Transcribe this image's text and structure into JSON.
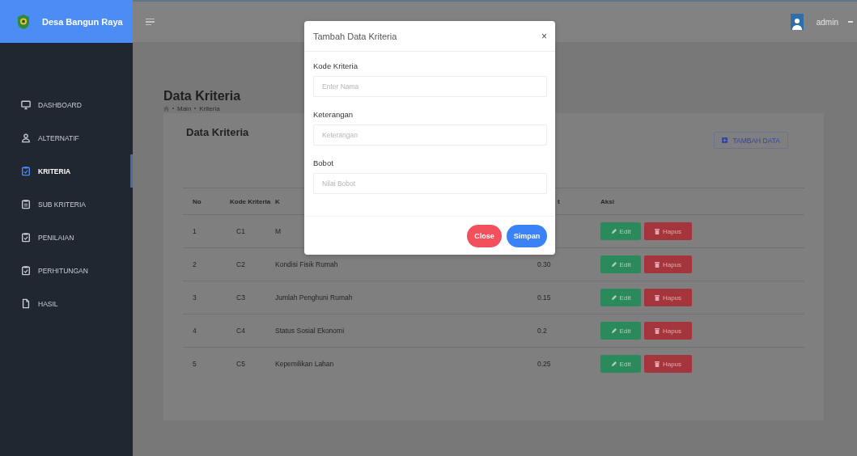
{
  "sidebar": {
    "brand": "Desa Bangun Raya",
    "items": [
      {
        "label": "DASHBOARD",
        "selected": false
      },
      {
        "label": "ALTERNATIF",
        "selected": false
      },
      {
        "label": "KRITERIA",
        "selected": true
      },
      {
        "label": "SUB KRITERIA",
        "selected": false
      },
      {
        "label": "PENILAIAN",
        "selected": false
      },
      {
        "label": "PERHITUNGAN",
        "selected": false
      },
      {
        "label": "HASIL",
        "selected": false
      }
    ]
  },
  "topbar": {
    "user": "admin"
  },
  "page": {
    "title": "Data Kriteria",
    "breadcrumb": [
      "Main",
      "Kriteria"
    ]
  },
  "card": {
    "title": "Data Kriteria",
    "add_button": "TAMBAH DATA"
  },
  "table": {
    "columns": [
      "No",
      "Kode Kriteria",
      "K",
      "t",
      "Aksi"
    ],
    "rows": [
      {
        "no": "1",
        "code": "C1",
        "description": "M",
        "actions": [
          {
            "label": "Edit",
            "kind": "edit"
          },
          {
            "label": "Hapus",
            "kind": "delete"
          }
        ]
      },
      {
        "no": "2",
        "code": "C2",
        "description": "Kondisi Fisik Rumah",
        "weight": "0.30",
        "actions": [
          {
            "label": "Edit",
            "kind": "edit"
          },
          {
            "label": "Hapus",
            "kind": "delete"
          }
        ]
      },
      {
        "no": "3",
        "code": "C3",
        "description": "Jumlah Penghuni Rumah",
        "weight": "0.15",
        "actions": [
          {
            "label": "Edit",
            "kind": "edit"
          },
          {
            "label": "Hapus",
            "kind": "delete"
          }
        ]
      },
      {
        "no": "4",
        "code": "C4",
        "description": "Status Sosial Ekonomi",
        "weight": "0.2",
        "actions": [
          {
            "label": "Edit",
            "kind": "edit"
          },
          {
            "label": "Hapus",
            "kind": "delete"
          }
        ]
      },
      {
        "no": "5",
        "code": "C5",
        "description": "Kepemilikan Lahan",
        "weight": "0.25",
        "actions": [
          {
            "label": "Edit",
            "kind": "edit"
          },
          {
            "label": "Hapus",
            "kind": "delete"
          }
        ]
      }
    ]
  },
  "modal": {
    "title": "Tambah Data Kriteria",
    "close": "×",
    "fields": [
      {
        "label": "Kode Kriteria",
        "placeholder": "Enter Nama"
      },
      {
        "label": "Keterangan",
        "placeholder": "Keterangan"
      },
      {
        "label": "Bobot",
        "placeholder": "Nilai Bobot"
      }
    ],
    "buttons": [
      {
        "label": "Close",
        "kind": "danger"
      },
      {
        "label": "Simpan",
        "kind": "primary"
      }
    ]
  }
}
